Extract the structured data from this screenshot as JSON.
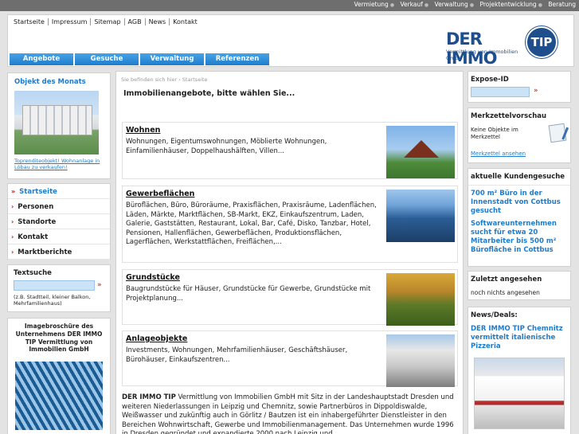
{
  "topbar": {
    "links": [
      "Vermietung",
      "Verkauf",
      "Verwaltung",
      "Projektentwicklung",
      "Beratung"
    ]
  },
  "header": {
    "topnav": [
      "Startseite",
      "Impressum",
      "Sitemap",
      "AGB",
      "News",
      "Kontakt"
    ],
    "logo_title": "DER IMMO",
    "logo_seal": "TIP",
    "logo_subtitle": "Vermittlung von Immobilien GmbH",
    "mainnav": [
      "Angebote",
      "Gesuche",
      "Verwaltung",
      "Referenzen"
    ]
  },
  "left": {
    "objekt_title": "Objekt des Monats",
    "objekt_caption": "Toprenditeobjekt! Wohnanlage in Löbau zu verkaufen!",
    "menu": [
      "Startseite",
      "Personen",
      "Standorte",
      "Kontakt",
      "Marktberichte"
    ],
    "search_label": "Textsuche",
    "search_hint": "(z.B. Stadtteil, kleiner Balkon, Mehrfamilienhaus)",
    "brochure_title": "Imagebroschüre des Unternehmens DER IMMO TIP Vermittlung von Immobilien GmbH"
  },
  "center": {
    "breadcrumb": "Sie befinden sich hier  ›  Startseite",
    "headline": "Immobilienangebote, bitte wählen Sie...",
    "listings": [
      {
        "title": "Wohnen",
        "text": "Wohnungen, Eigentumswohnungen, Möblierte Wohnungen, Einfamilienhäuser, Doppelhaushälften, Villen..."
      },
      {
        "title": "Gewerbeflächen",
        "text": "Büroflächen, Büro, Büroräume, Praxisflächen, Praxisräume, Ladenflächen, Läden, Märkte, Marktflächen, SB-Markt, EKZ, Einkaufszentrum, Laden, Galerie, Gaststätten, Restaurant, Lokal, Bar, Café, Disko, Tanzbar, Hotel, Pensionen, Hallenflächen, Gewerbeflächen, Produktionsflächen, Lagerflächen, Werkstattflächen, Freiflächen,..."
      },
      {
        "title": "Grundstücke",
        "text": "Baugrundstücke für Häuser, Grundstücke für Gewerbe, Grundstücke mit Projektplanung..."
      },
      {
        "title": "Anlageobjekte",
        "text": "Investments, Wohnungen, Mehrfamilienhäuser, Geschäftshäuser, Bürohäuser, Einkaufszentren..."
      }
    ],
    "about_bold": "DER IMMO TIP",
    "about_text": " Vermittlung von Immobilien GmbH mit Sitz in der Landeshauptstadt Dresden und weiteren Niederlassungen in Leipzig und Chemnitz, sowie Partnerbüros in Dippoldiswalde, Weißwasser und zukünftig auch in Görlitz / Bautzen ist ein inhabergeführter Dienstleister in den Bereichen Wohnwirtschaft, Gewerbe und Immobilienmanagement. Das Unternehmen wurde 1996 in Dresden gegründet und expandierte 2000 nach Leipzig und"
  },
  "right": {
    "expose_title": "Expose-ID",
    "merk_title": "Merkzettelvorschau",
    "merk_text": "Keine Objekte im Merkzettel",
    "merk_link": "Merkzettel ansehen",
    "gesuche_title": "aktuelle Kundengesuche",
    "gesuche": [
      "700 m² Büro in der Innenstadt von Cottbus gesucht",
      "Softwareunternehmen sucht für etwa 20 Mitarbeiter bis 500 m² Bürofläche in Cottbus"
    ],
    "zuletzt_title": "Zuletzt angesehen",
    "zuletzt_text": "noch nichts angesehen",
    "news_title": "News/Deals:",
    "news_item": "DER IMMO TIP Chemnitz vermittelt italienische Pizzeria"
  },
  "colors": {
    "accent_blue": "#1f7ccc",
    "logo_blue": "#1e4f8c",
    "arrow_red": "#dd0000"
  },
  "icons": [
    "arrow-right-icon",
    "notepad-icon"
  ]
}
